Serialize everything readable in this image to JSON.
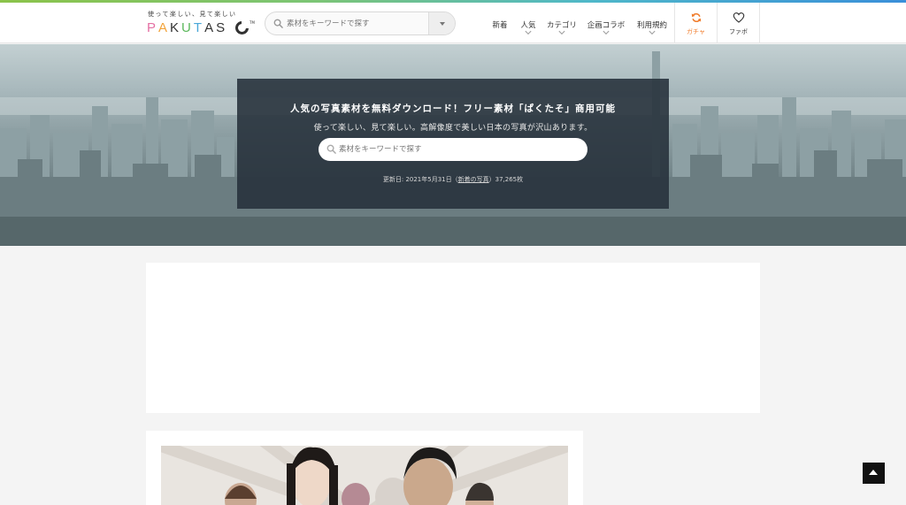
{
  "logo": {
    "tagline": "使って楽しい、見て楽しい",
    "wordmark": [
      "P",
      "A",
      "K",
      "U",
      "T",
      "A",
      "S"
    ],
    "wordmark_colors": [
      "#e56fa3",
      "#f2a33a",
      "#333333",
      "#5cb85c",
      "#4aa8d8",
      "#333333",
      "#333333"
    ],
    "tm": "TM"
  },
  "header_search": {
    "placeholder": "素材をキーワードで探す"
  },
  "nav": {
    "items": [
      {
        "label": "新着",
        "has_dropdown": false
      },
      {
        "label": "人気",
        "has_dropdown": true
      },
      {
        "label": "カテゴリ",
        "has_dropdown": true
      },
      {
        "label": "企画コラボ",
        "has_dropdown": true
      },
      {
        "label": "利用規約",
        "has_dropdown": true
      }
    ],
    "gacha": {
      "label": "ガチャ",
      "icon": "refresh-icon",
      "color": "#f07b2a"
    },
    "favorites": {
      "label": "ファボ",
      "icon": "heart-icon"
    }
  },
  "hero": {
    "title": "人気の写真素材を無料ダウンロード！フリー素材「ぱくたそ」商用可能",
    "subtitle": "使って楽しい、見て楽しい。高解像度で美しい日本の写真が沢山あります。",
    "search_placeholder": "素材をキーワードで探す",
    "update_prefix": "更新日: 2021年5月31日（",
    "update_link": "新着の写真",
    "update_suffix": "）37,265枚"
  },
  "page_top": {
    "icon": "arrow-up-icon"
  }
}
